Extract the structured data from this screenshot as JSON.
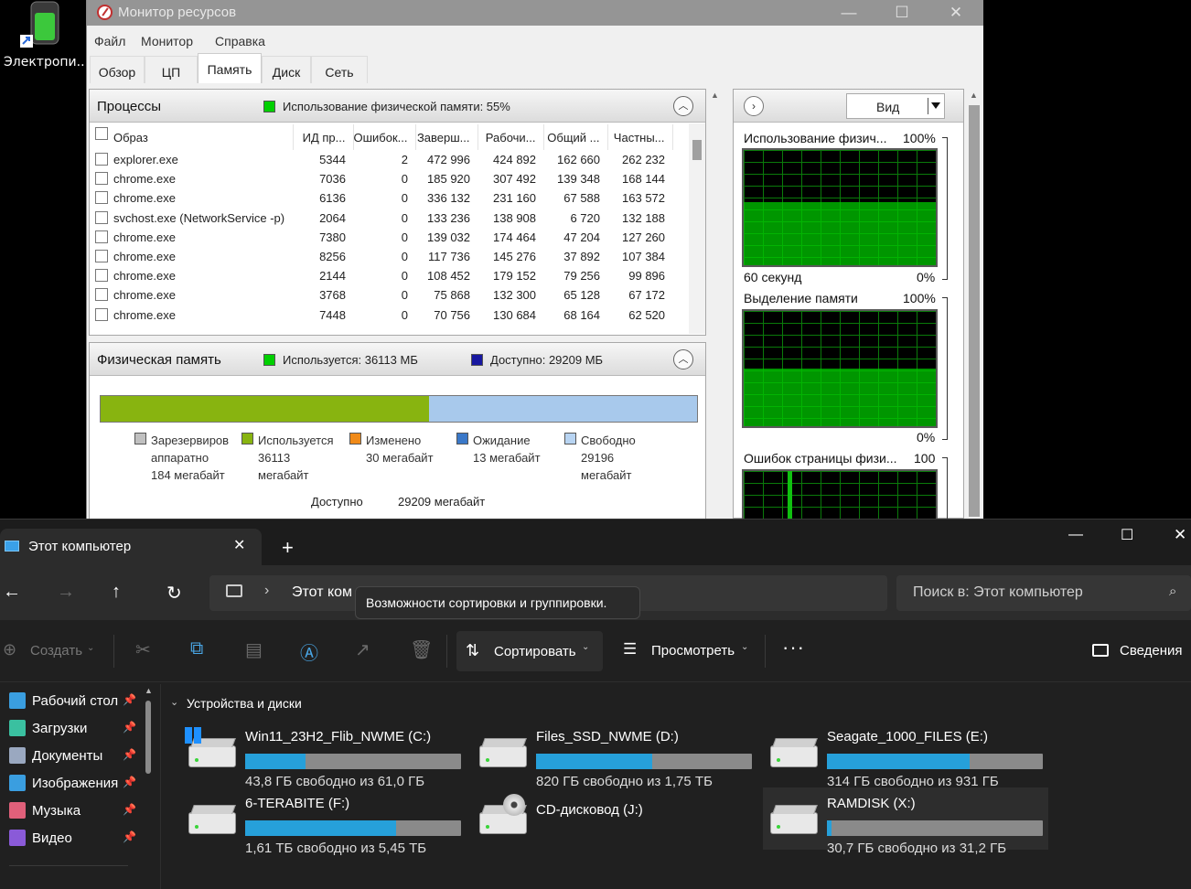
{
  "desktop": {
    "icon_label": "Электропи..."
  },
  "resmon": {
    "title": "Монитор ресурсов",
    "menu": [
      "Файл",
      "Монитор",
      "Справка"
    ],
    "tabs": [
      "Обзор",
      "ЦП",
      "Память",
      "Диск",
      "Сеть"
    ],
    "active_tab": "Память",
    "processes": {
      "title": "Процессы",
      "legend": "Использование физической памяти: 55%",
      "columns": [
        "Образ",
        "ИД пр...",
        "Ошибок...",
        "Заверш...",
        "Рабочи...",
        "Общий ...",
        "Частны..."
      ],
      "rows": [
        [
          "explorer.exe",
          "5344",
          "2",
          "472 996",
          "424 892",
          "162 660",
          "262 232"
        ],
        [
          "chrome.exe",
          "7036",
          "0",
          "185 920",
          "307 492",
          "139 348",
          "168 144"
        ],
        [
          "chrome.exe",
          "6136",
          "0",
          "336 132",
          "231 160",
          "67 588",
          "163 572"
        ],
        [
          "svchost.exe (NetworkService -p)",
          "2064",
          "0",
          "133 236",
          "138 908",
          "6 720",
          "132 188"
        ],
        [
          "chrome.exe",
          "7380",
          "0",
          "139 032",
          "174 464",
          "47 204",
          "127 260"
        ],
        [
          "chrome.exe",
          "8256",
          "0",
          "117 736",
          "145 276",
          "37 892",
          "107 384"
        ],
        [
          "chrome.exe",
          "2144",
          "0",
          "108 452",
          "179 152",
          "79 256",
          "99 896"
        ],
        [
          "chrome.exe",
          "3768",
          "0",
          "75 868",
          "132 300",
          "65 128",
          "67 172"
        ],
        [
          "chrome.exe",
          "7448",
          "0",
          "70 756",
          "130 684",
          "68 164",
          "62 520"
        ]
      ]
    },
    "physical": {
      "title": "Физическая память",
      "used_legend": "Используется: 36113 МБ",
      "avail_legend": "Доступно: 29209 МБ",
      "used_fraction": 0.55,
      "categories": [
        {
          "lines": [
            "Зарезервиров",
            "аппаратно",
            "184 мегабайт"
          ],
          "color": "#c0c0c0"
        },
        {
          "lines": [
            "Используется",
            "36113",
            "мегабайт"
          ],
          "color": "#88b410"
        },
        {
          "lines": [
            "Изменено",
            "30 мегабайт"
          ],
          "color": "#f08a18"
        },
        {
          "lines": [
            "Ожидание",
            "13 мегабайт"
          ],
          "color": "#3a78c8"
        },
        {
          "lines": [
            "Свободно",
            "29196",
            "мегабайт"
          ],
          "color": "#b8d4f2"
        }
      ],
      "summary_label": "Доступно",
      "summary_value": "29209 мегабайт",
      "colors": {
        "used": "#88b410",
        "available": "#a8c9ec"
      }
    },
    "graphs": {
      "view_label": "Вид",
      "items": [
        {
          "label": "Использование физич...",
          "max": "100%",
          "left": "60 секунд",
          "min": "0%",
          "level": 0.55
        },
        {
          "label": "Выделение памяти",
          "max": "100%",
          "min": "0%",
          "level": 0.5
        },
        {
          "label": "Ошибок страницы физи...",
          "max": "100"
        }
      ]
    }
  },
  "explorer": {
    "tab_title": "Этот компьютер",
    "address": "Этот ком",
    "search_placeholder": "Поиск в: Этот компьютер",
    "tooltip": "Возможности сортировки и группировки.",
    "toolbar": {
      "create": "Создать",
      "sort": "Сортировать",
      "view": "Просмотреть",
      "details": "Сведения"
    },
    "sidebar": [
      {
        "label": "Рабочий стол",
        "color": "#3a9ee0"
      },
      {
        "label": "Загрузки",
        "color": "#3ac0a0"
      },
      {
        "label": "Документы",
        "color": "#9aa8c0"
      },
      {
        "label": "Изображения",
        "color": "#3a9ee0"
      },
      {
        "label": "Музыка",
        "color": "#e0607a"
      },
      {
        "label": "Видео",
        "color": "#8a5ad8"
      }
    ],
    "group_header": "Устройства и диски",
    "drives": [
      {
        "name": "Win11_23H2_Flib_NWME (C:)",
        "free": "43,8 ГБ свободно из 61,0 ГБ",
        "used_fraction": 0.28
      },
      {
        "name": "Files_SSD_NWME (D:)",
        "free": "820 ГБ свободно из 1,75 ТБ",
        "used_fraction": 0.54
      },
      {
        "name": "Seagate_1000_FILES (E:)",
        "free": "314 ГБ свободно из 931 ГБ",
        "used_fraction": 0.66
      },
      {
        "name": "6-TERABITE (F:)",
        "free": "1,61 ТБ свободно из 5,45 ТБ",
        "used_fraction": 0.7
      },
      {
        "name": "CD-дисковод (J:)"
      },
      {
        "name": "RAMDISK (X:)",
        "free": "30,7 ГБ свободно из 31,2 ГБ",
        "used_fraction": 0.02
      }
    ]
  }
}
